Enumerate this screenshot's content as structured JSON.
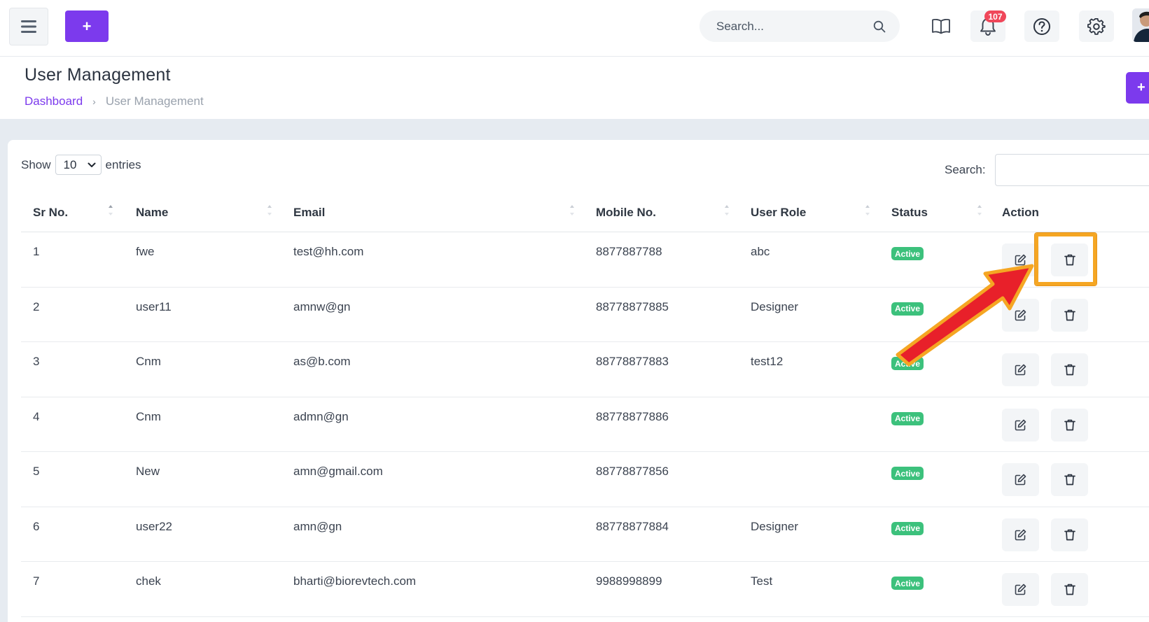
{
  "topbar": {
    "add_label": "+",
    "search_placeholder": "Search...",
    "notification_count": "107",
    "icons": [
      "hamburger-icon",
      "search-icon",
      "book-icon",
      "bell-icon",
      "help-icon",
      "gear-icon",
      "avatar"
    ]
  },
  "page": {
    "title": "User Management",
    "breadcrumb": {
      "link": "Dashboard",
      "separator": "›",
      "current": "User Management"
    },
    "action_label": "+"
  },
  "table_controls": {
    "show_label": "Show",
    "entries_value": "10",
    "entries_label": "entries",
    "search_label": "Search:"
  },
  "table": {
    "columns": [
      "Sr No.",
      "Name",
      "Email",
      "Mobile No.",
      "User Role",
      "Status",
      "Action"
    ],
    "rows": [
      {
        "sr": "1",
        "name": "fwe",
        "email": "test@hh.com",
        "mobile": "8877887788",
        "role": "abc",
        "status": "Active"
      },
      {
        "sr": "2",
        "name": "user11",
        "email": "amnw@gn",
        "mobile": "88778877885",
        "role": "Designer",
        "status": "Active"
      },
      {
        "sr": "3",
        "name": "Cnm",
        "email": "as@b.com",
        "mobile": "88778877883",
        "role": "test12",
        "status": "Active"
      },
      {
        "sr": "4",
        "name": "Cnm",
        "email": "admn@gn",
        "mobile": "88778877886",
        "role": "",
        "status": "Active"
      },
      {
        "sr": "5",
        "name": "New",
        "email": "amn@gmail.com",
        "mobile": "88778877856",
        "role": "",
        "status": "Active"
      },
      {
        "sr": "6",
        "name": "user22",
        "email": "amn@gn",
        "mobile": "88778877884",
        "role": "Designer",
        "status": "Active"
      },
      {
        "sr": "7",
        "name": "chek",
        "email": "bharti@biorevtech.com",
        "mobile": "9988998899",
        "role": "Test",
        "status": "Active"
      }
    ]
  },
  "colors": {
    "accent": "#7c3aed",
    "status_active": "#3cc17c",
    "badge_red": "#f0475a",
    "annotation_orange": "#f5a623",
    "annotation_red": "#e8202a"
  }
}
